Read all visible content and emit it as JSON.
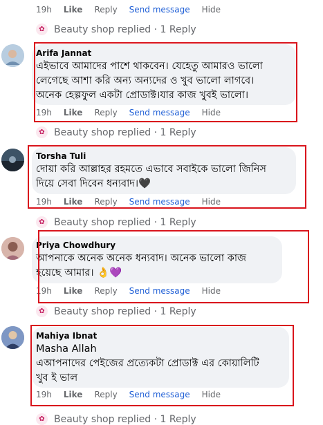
{
  "actions": {
    "time": "19h",
    "like": "Like",
    "reply": "Reply",
    "send": "Send message",
    "hide": "Hide"
  },
  "replied_text": "Beauty shop replied · 1 Reply",
  "comments": [
    {
      "author": "Arifa Jannat",
      "lines": [
        "এইভাবে আমাদের পাশে থাকবেন। যেহেতু আমারও ভালো",
        "লেগেছে আশা করি অন্য অন্যদের ও খুব ভালো লাগবে।",
        "অনেক হেল্পফুল একটা প্রোডাক্ট।যার কাজ খুবই ভালো।"
      ]
    },
    {
      "author": "Torsha Tuli",
      "lines": [
        "দোয়া করি আল্লাহর রহমতে এভাবে সবাইকে ভালো জিনিস",
        "দিয়ে সেবা দিবেন ধন্যবাদ।🖤"
      ]
    },
    {
      "author": "Priya Chowdhury",
      "lines": [
        "আপনাকে অনেক অনেক ধন্যবাদ। অনেক ভালো কাজ",
        "হয়েছে আমার। 👌💜"
      ]
    },
    {
      "author": "Mahiya Ibnat",
      "lines": [
        "Masha Allah",
        "এআপনাদের পেইজের প্রত্যেকটা প্রোডাক্ট এর কোয়ালিটি",
        "খুব ই ভাল"
      ]
    }
  ],
  "colors": {
    "highlight": "#d9141c",
    "link": "#1f5fd6",
    "bubble": "#f0f2f5",
    "muted": "#65676b"
  },
  "icons": {
    "page_avatar": "beauty-shop-logo-icon"
  }
}
